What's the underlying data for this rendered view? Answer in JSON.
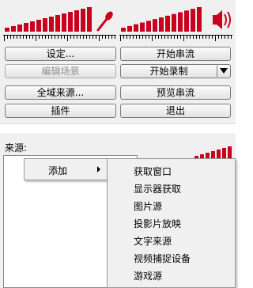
{
  "colors": {
    "meter_bar": "#c8001e",
    "panel_bg": "#f0f0f0"
  },
  "meters": {
    "mic": {
      "icon": "microphone-icon"
    },
    "speaker": {
      "icon": "speaker-icon"
    }
  },
  "buttons": {
    "settings": "设定...",
    "edit_scene": "编辑场景",
    "global_sources": "全域来源...",
    "plugins": "插件",
    "start_streaming": "开始串流",
    "start_recording": "开始录制",
    "preview_stream": "预览串流",
    "exit": "退出"
  },
  "sources": {
    "label": "来源:"
  },
  "context_menu": {
    "add_label": "添加"
  },
  "submenu": {
    "items": [
      "获取窗口",
      "显示器获取",
      "图片源",
      "投影片放映",
      "文字来源",
      "视频捕捉设备",
      "游戏源"
    ]
  }
}
